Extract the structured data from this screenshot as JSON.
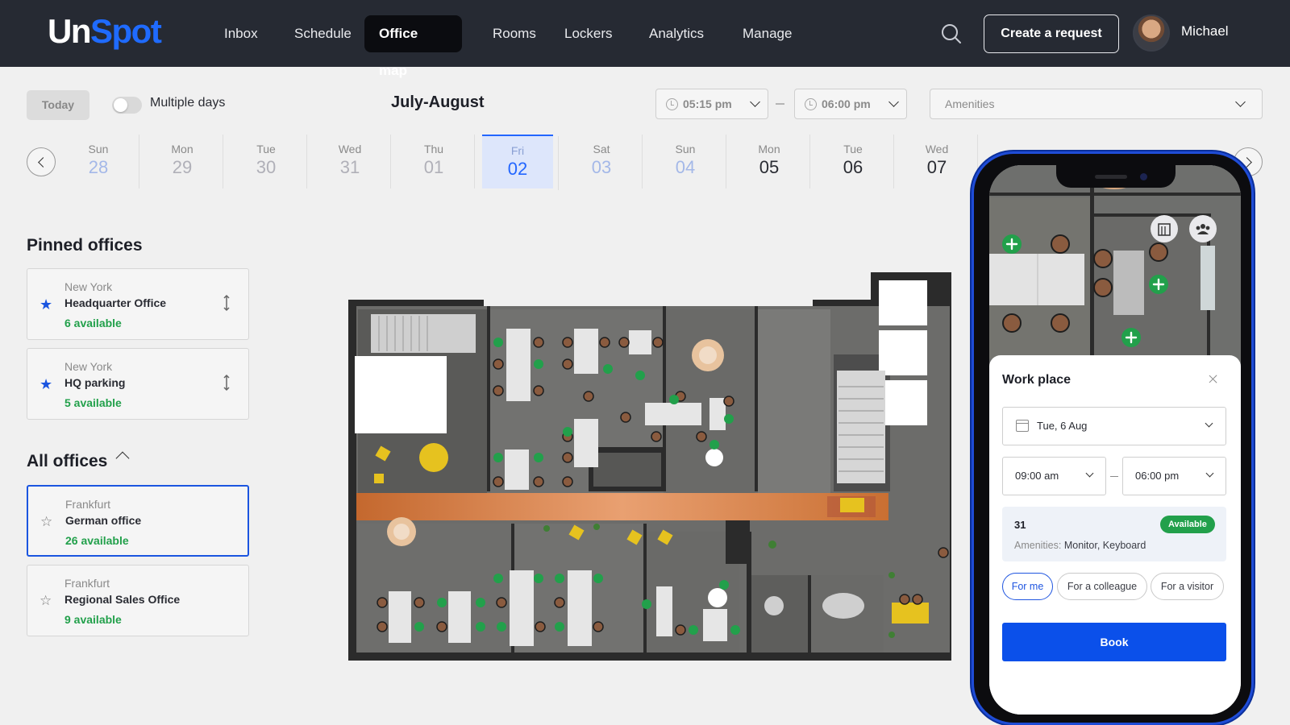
{
  "app": {
    "logo_part1": "Un",
    "logo_part2": "Spot",
    "brand_color": "#1f6bff"
  },
  "nav": {
    "items": [
      {
        "label": "Inbox",
        "active": false
      },
      {
        "label": "Schedule",
        "active": false
      },
      {
        "label": "Office map",
        "active": true
      },
      {
        "label": "Rooms",
        "active": false
      },
      {
        "label": "Lockers",
        "active": false
      },
      {
        "label": "Analytics",
        "active": false
      },
      {
        "label": "Manage",
        "active": false
      }
    ],
    "search_icon": "search-icon",
    "create_label": "Create a request",
    "user_name": "Michael"
  },
  "toolbar": {
    "today_label": "Today",
    "multiple_days_label": "Multiple days",
    "multiple_days_on": false,
    "month_label": "July-August",
    "time_from": "05:15 pm",
    "time_to": "06:00 pm",
    "amenities_placeholder": "Amenities"
  },
  "dates": [
    {
      "name": "Sun",
      "num": "28",
      "state": "weekend"
    },
    {
      "name": "Mon",
      "num": "29",
      "state": "muted"
    },
    {
      "name": "Tue",
      "num": "30",
      "state": "muted"
    },
    {
      "name": "Wed",
      "num": "31",
      "state": "muted"
    },
    {
      "name": "Thu",
      "num": "01",
      "state": "muted"
    },
    {
      "name": "Fri",
      "num": "02",
      "state": "selected"
    },
    {
      "name": "Sat",
      "num": "03",
      "state": "weekend"
    },
    {
      "name": "Sun",
      "num": "04",
      "state": "weekend"
    },
    {
      "name": "Mon",
      "num": "05",
      "state": "future"
    },
    {
      "name": "Tue",
      "num": "06",
      "state": "future"
    },
    {
      "name": "Wed",
      "num": "07",
      "state": "future"
    }
  ],
  "pinned": {
    "title": "Pinned offices",
    "offices": [
      {
        "city": "New York",
        "name": "Headquarter Office",
        "available": "6 available"
      },
      {
        "city": "New York",
        "name": "HQ parking",
        "available": "5 available"
      }
    ]
  },
  "all_offices": {
    "title": "All offices",
    "offices": [
      {
        "city": "Frankfurt",
        "name": "German office",
        "available": "26 available",
        "selected": true
      },
      {
        "city": "Frankfurt",
        "name": "Regional Sales Office",
        "available": "9 available",
        "selected": false
      }
    ]
  },
  "booking": {
    "title": "Work place",
    "date": "Tue, 6 Aug",
    "from": "09:00 am",
    "to": "06:00 pm",
    "seat_id": "31",
    "status": "Available",
    "amenities_label": "Amenities:",
    "amenities_value": "Monitor, Keyboard",
    "options": [
      "For me",
      "For a colleague",
      "For a visitor"
    ],
    "selected_option": "For me",
    "book_label": "Book"
  },
  "colors": {
    "available_green": "#22a04b",
    "accent_blue": "#0b50ea",
    "nav_bg": "#262a33"
  }
}
